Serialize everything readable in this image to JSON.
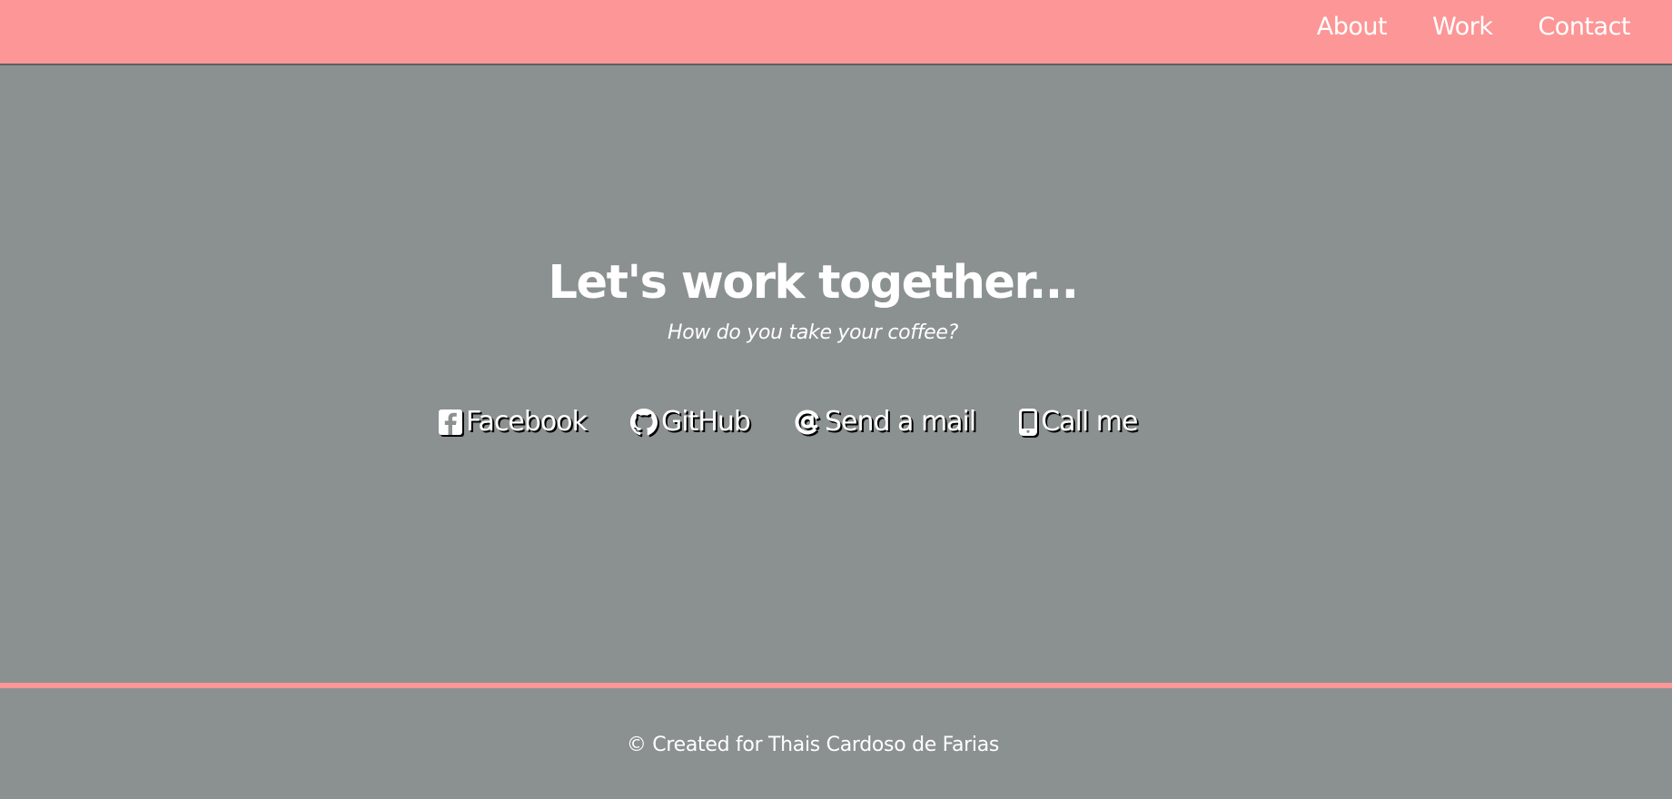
{
  "colors": {
    "navbar_background": "#fd9696",
    "page_background": "#8b9190",
    "text": "#ffffff",
    "accent_rule": "#fd9696"
  },
  "nav": {
    "items": [
      {
        "label": "About"
      },
      {
        "label": "Work"
      },
      {
        "label": "Contact"
      }
    ]
  },
  "hero": {
    "title": "Let's work together...",
    "subtitle": "How do you take your coffee?"
  },
  "contact": {
    "links": [
      {
        "label": "Facebook",
        "icon": "facebook-square-icon"
      },
      {
        "label": "GitHub",
        "icon": "github-icon"
      },
      {
        "label": "Send a mail",
        "icon": "at-sign-icon"
      },
      {
        "label": "Call me",
        "icon": "mobile-phone-icon"
      }
    ]
  },
  "footer": {
    "text": "© Created for Thais Cardoso de Farias"
  }
}
